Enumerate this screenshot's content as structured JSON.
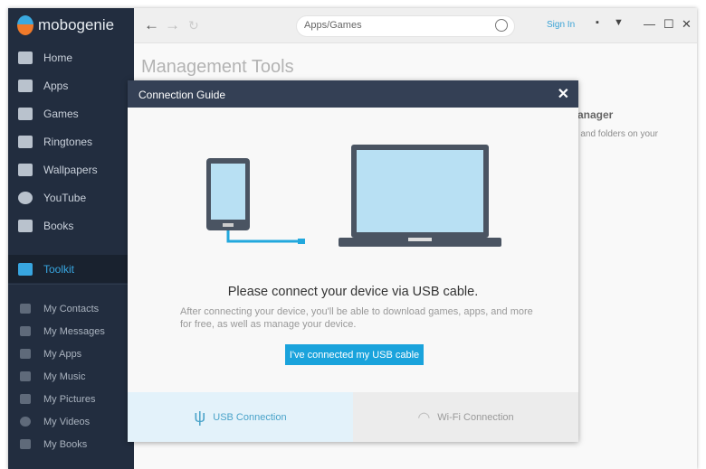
{
  "app": {
    "name": "mobogenie"
  },
  "sidebar": {
    "items": [
      {
        "label": "Home",
        "icon": "home-icon"
      },
      {
        "label": "Apps",
        "icon": "apps-icon"
      },
      {
        "label": "Games",
        "icon": "gamepad-icon"
      },
      {
        "label": "Ringtones",
        "icon": "music-note-icon"
      },
      {
        "label": "Wallpapers",
        "icon": "image-icon"
      },
      {
        "label": "YouTube",
        "icon": "play-icon"
      },
      {
        "label": "Books",
        "icon": "book-icon"
      }
    ],
    "toolkit": "Toolkit",
    "sub_items": [
      {
        "label": "My Contacts"
      },
      {
        "label": "My Messages"
      },
      {
        "label": "My Apps"
      },
      {
        "label": "My Music"
      },
      {
        "label": "My Pictures"
      },
      {
        "label": "My Videos"
      },
      {
        "label": "My Books"
      }
    ]
  },
  "topbar": {
    "search_value": "Apps/Games",
    "sign_in": "Sign In"
  },
  "main": {
    "title": "Management Tools",
    "fm_title": "Manager",
    "fm_desc": "es and folders on your"
  },
  "dialog": {
    "title": "Connection Guide",
    "message": "Please connect your device via USB cable.",
    "description": "After connecting your device, you'll be able to download games, apps, and more for free, as well as manage your device.",
    "button": "I've connected my USB cable",
    "tabs": [
      {
        "label": "USB Connection",
        "selected": true
      },
      {
        "label": "Wi-Fi Connection",
        "selected": false
      }
    ]
  },
  "colors": {
    "accent": "#1aa3dc",
    "sidebar": "#222d3f",
    "dialog_header": "#344055"
  }
}
